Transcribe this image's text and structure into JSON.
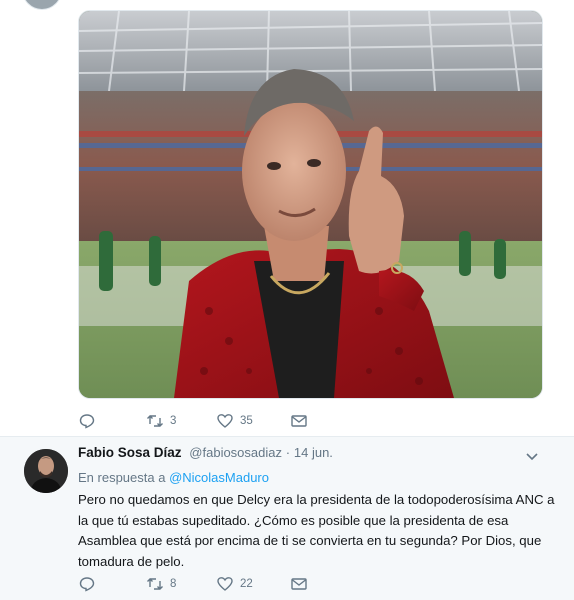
{
  "tweet1": {
    "media_alt": "photo",
    "actions": {
      "reply_count": "",
      "retweet_count": "3",
      "like_count": "35"
    }
  },
  "tweet2": {
    "author_name": "Fabio Sosa Díaz",
    "author_handle": "@fabiososadiaz",
    "separator": "·",
    "timestamp": "14 jun.",
    "reply_prefix": "En respuesta a",
    "reply_mention": "@NicolasMaduro",
    "text_lines": [
      "Pero no quedamos en que Delcy era la presidenta de la todopoderosísima ANC a",
      "la que tú estabas supeditado. ¿Cómo es posible que la presidenta de esa",
      "Asamblea que está por encima de ti se convierta en tu segunda? Por Dios, que",
      "tomadura de pelo."
    ],
    "actions": {
      "reply_count": "",
      "retweet_count": "8",
      "like_count": "22"
    }
  },
  "colors": {
    "accent": "#1da1f2",
    "secondary_text": "#657786",
    "primary_text": "#14171a",
    "reply_bg": "#f5f8fa"
  }
}
